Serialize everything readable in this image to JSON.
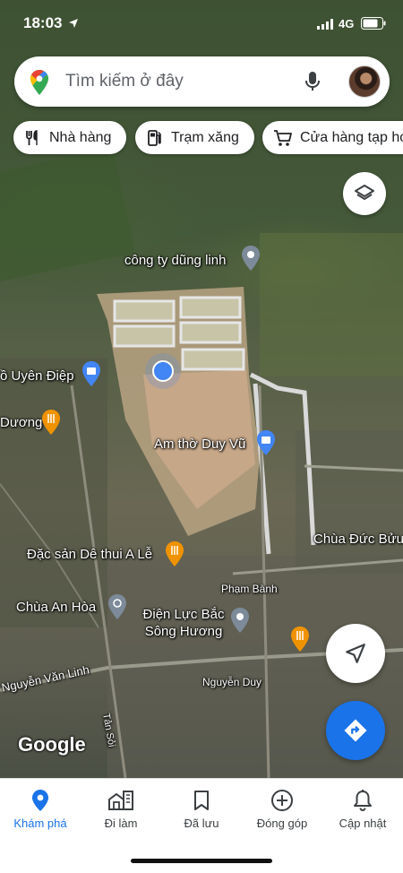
{
  "status_bar": {
    "time": "18:03",
    "network": "4G"
  },
  "search": {
    "placeholder": "Tìm kiếm ở đây"
  },
  "chips": [
    {
      "label": "Nhà hàng",
      "icon": "restaurant-icon"
    },
    {
      "label": "Trạm xăng",
      "icon": "gas-station-icon"
    },
    {
      "label": "Cửa hàng tạp hóa",
      "icon": "cart-icon"
    }
  ],
  "map": {
    "places": [
      {
        "name": "công ty dũng linh",
        "type": "place"
      },
      {
        "name": "ồ Uyên Điệp",
        "type": "shopping"
      },
      {
        "name": "Dương",
        "type": "restaurant"
      },
      {
        "name": "Am thờ Duy Vũ",
        "type": "shopping"
      },
      {
        "name": "Chùa Đức Bửu",
        "type": "place"
      },
      {
        "name": "Đặc sản Dê thui A Lễ",
        "type": "restaurant"
      },
      {
        "name": "Chùa An Hòa",
        "type": "worship"
      },
      {
        "name": "Điện Lực Bắc Sông Hương",
        "type": "place"
      }
    ],
    "streets": [
      "Phạm Bành",
      "Nguyễn Văn Linh",
      "Nguyễn Duy",
      "Tản Sỏi"
    ],
    "logo": "Google"
  },
  "bottom_nav": [
    {
      "label": "Khám phá",
      "icon": "explore-pin-icon",
      "active": true
    },
    {
      "label": "Đi làm",
      "icon": "commute-icon",
      "active": false
    },
    {
      "label": "Đã lưu",
      "icon": "bookmark-icon",
      "active": false
    },
    {
      "label": "Đóng góp",
      "icon": "add-circle-icon",
      "active": false
    },
    {
      "label": "Cập nhật",
      "icon": "bell-icon",
      "active": false
    }
  ],
  "colors": {
    "accent": "#1a73e8",
    "location_dot": "#4285f4"
  }
}
